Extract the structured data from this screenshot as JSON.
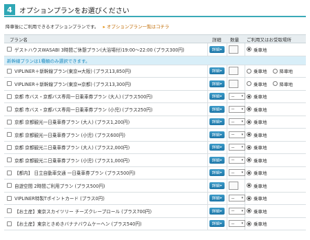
{
  "header": {
    "step": "4",
    "title": "オプションプランをお選びください"
  },
  "intro": {
    "text": "降車後にご利用できるオプションプランです。",
    "arrow": "▸",
    "link": "オプションプラン一覧はコチラ"
  },
  "table": {
    "columns": {
      "name": "プラン名",
      "detail": "詳細",
      "qty": "数量",
      "place": "ご利用又はお受取場所"
    },
    "detail_label": "詳細",
    "qty_default": "－",
    "place_options": {
      "alight": "乗車地",
      "descend": "降車地"
    },
    "notice": "新幹線プランは1種類のみ選択できます。",
    "items": [
      {
        "name": "ゲストハウスWASABI 3時間ご休憩プラン(大浴場付)19:00～22:00 (プラス300円)",
        "qty": "box",
        "place": "single"
      },
      {
        "name": "VIPLINER＋新幹線プラン(東京⇔大阪) (プラス13,850円)",
        "qty": "box",
        "place": "double"
      },
      {
        "name": "VIPLINER＋新幹線プラン(東京⇔京都) (プラス13,300円)",
        "qty": "box",
        "place": "double"
      },
      {
        "name": "京都 市バス・京都バス専用一日乗車券プラン (大人) (プラス500円)",
        "qty": "select",
        "place": "single"
      },
      {
        "name": "京都 市バス・京都バス専用一日乗車券プラン (小児) (プラス250円)",
        "qty": "select",
        "place": "single"
      },
      {
        "name": "京都 京都観光一日乗車券プラン (大人) (プラス1,200円)",
        "qty": "select",
        "place": "single"
      },
      {
        "name": "京都 京都観光一日乗車券プラン (小児) (プラス600円)",
        "qty": "select",
        "place": "single"
      },
      {
        "name": "京都 京都観光二日乗車券プラン (大人) (プラス2,000円)",
        "qty": "select",
        "place": "single"
      },
      {
        "name": "京都 京都観光二日乗車券プラン (小児) (プラス1,000円)",
        "qty": "select",
        "place": "single"
      },
      {
        "name": "【都内】 日立自動車交通 一日乗車券プラン (プラス500円)",
        "qty": "select",
        "place": "single"
      },
      {
        "name": "自遊空間 2時間ご利用プラン (プラス500円)",
        "qty": "box",
        "place": "single"
      },
      {
        "name": "VIPLINER特製Tポイントカード (プラス0円)",
        "qty": "select",
        "place": "single"
      },
      {
        "name": "【お土産】東京スカイツリー チーズクレープロール (プラス700円)",
        "qty": "select",
        "place": "single"
      },
      {
        "name": "【お土産】東京ときめきバナナバウムケーヘン (プラス540円)",
        "qty": "select",
        "place": "single"
      }
    ]
  }
}
